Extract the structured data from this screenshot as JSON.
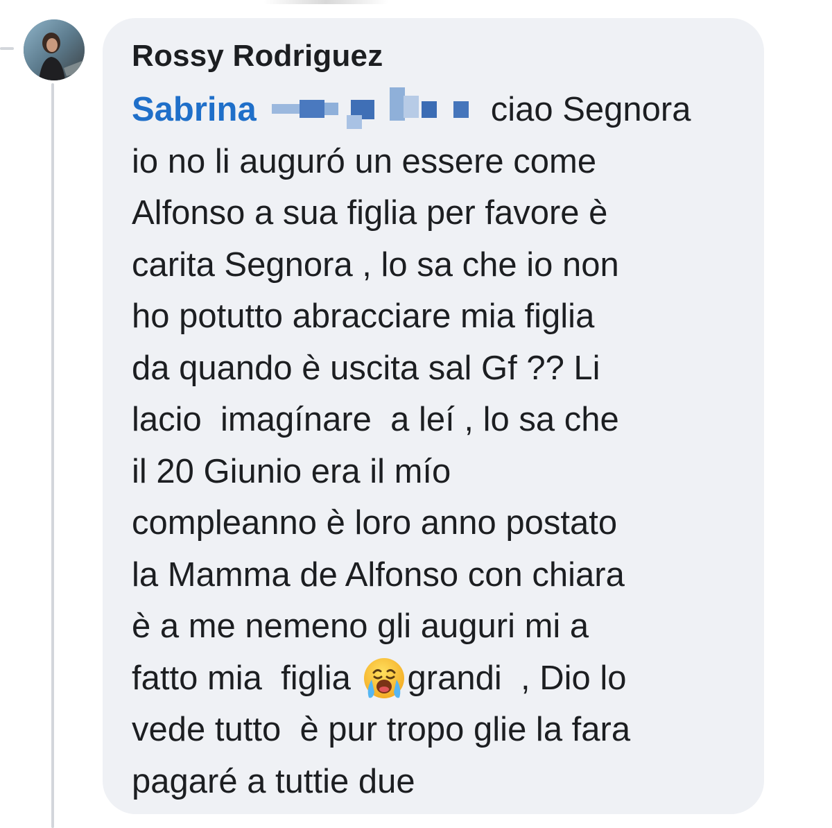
{
  "comment": {
    "author": "Rossy Rodriguez",
    "mention": "Sabrina",
    "lines": [
      "ciao Segnora",
      "io no li auguró un essere come",
      "Alfonso a sua figlia per favore è",
      "carita Segnora , lo sa che io non",
      "ho potutto abracciare mia figlia",
      "da quando è uscita sal Gf ?? Li",
      "lacio  imagínare  a leí , lo sa che",
      "il 20 Giunio era il mío",
      "compleanno è loro anno postato",
      "la Mamma de Alfonso con chiara",
      "è a me nemeno gli auguri mi a",
      "fatto mia  figlia ",
      "grandi  , Dio lo",
      "vede tutto  è pur tropo glie la fara",
      "pagaré a tuttie due"
    ],
    "emoji": "crying-face-icon"
  },
  "colors": {
    "bubble": "#eff1f5",
    "mention": "#1f6fc9",
    "text": "#1c1e21",
    "thread_line": "#d3d6db"
  }
}
